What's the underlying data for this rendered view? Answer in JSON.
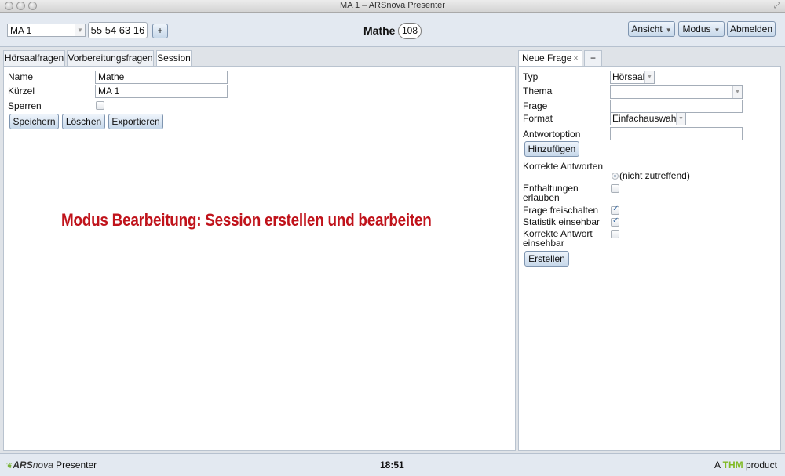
{
  "window": {
    "title": "MA 1 – ARSnova Presenter"
  },
  "toolbar": {
    "session_select": "MA 1",
    "session_key": "55 54 63 16",
    "add_label": "+",
    "session_name": "Mathe",
    "user_count": "108",
    "view_menu": "Ansicht",
    "mode_menu": "Modus",
    "logout": "Abmelden"
  },
  "left": {
    "tabs": [
      "Hörsaalfragen",
      "Vorbereitungsfragen",
      "Session"
    ],
    "active_tab": "Session",
    "form": {
      "name_label": "Name",
      "name_value": "Mathe",
      "short_label": "Kürzel",
      "short_value": "MA 1",
      "lock_label": "Sperren",
      "lock_checked": false
    },
    "buttons": {
      "save": "Speichern",
      "delete": "Löschen",
      "export": "Exportieren"
    },
    "overlay_caption": "Modus Bearbeitung: Session erstellen und bearbeiten"
  },
  "right": {
    "tabs": {
      "new_question": "Neue Frage",
      "close": "×",
      "add": "+"
    },
    "form": {
      "type_label": "Typ",
      "type_value": "Hörsaal",
      "topic_label": "Thema",
      "topic_value": "",
      "question_label": "Frage",
      "question_value": "",
      "format_label": "Format",
      "format_value": "Einfachauswahl",
      "answer_option_label": "Antwortoption",
      "answer_option_value": "",
      "add_button": "Hinzufügen",
      "correct_answers_label": "Korrekte Antworten",
      "correct_answers_none": "(nicht zutreffend)",
      "abstain_label_1": "Enthaltungen",
      "abstain_label_2": "erlauben",
      "abstain_checked": false,
      "release_label": "Frage freischalten",
      "release_checked": true,
      "stats_label": "Statistik einsehbar",
      "stats_checked": true,
      "correct_visible_label_1": "Korrekte Antwort",
      "correct_visible_label_2": "einsehbar",
      "correct_visible_checked": false,
      "create_button": "Erstellen"
    }
  },
  "footer": {
    "brand_ars": "ARS",
    "brand_nova": "nova",
    "brand_presenter": "Presenter",
    "time": "18:51",
    "thm_prefix": "A",
    "thm_name": "THM",
    "thm_suffix": "product"
  },
  "colors": {
    "accent_red": "#c0131b",
    "thm_green": "#80ba24",
    "toolbar_bg": "#e3e9f1"
  }
}
